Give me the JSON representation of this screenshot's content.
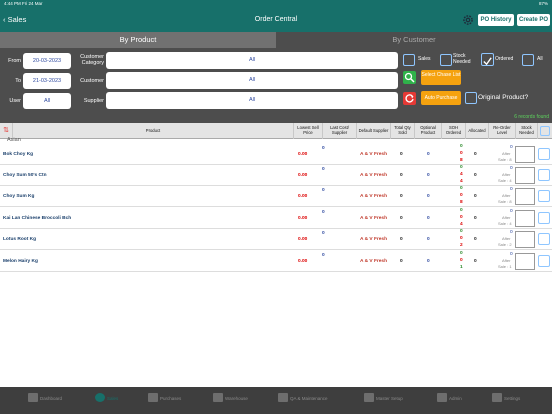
{
  "status": {
    "time": "4:44 PM",
    "date": "Fri 24 Mar",
    "battery": "87%"
  },
  "header": {
    "back_label": "Sales",
    "title": "Order Central",
    "po_history": "PO History",
    "create_po": "Create PO"
  },
  "segments": {
    "by_product": "By Product",
    "by_customer": "By Customer"
  },
  "filters": {
    "from_label": "From",
    "from_value": "20-03-2023",
    "to_label": "To",
    "to_value": "21-03-2023",
    "user_label": "User",
    "user_value": "All",
    "customer_category_label": "Customer Category",
    "customer_category_value": "All",
    "customer_label": "Customer",
    "customer_value": "All",
    "supplier_label": "Supplier",
    "supplier_value": "All",
    "sales_label": "Sales",
    "stock_needed_label": "Stock Needed",
    "ordered_label": "Ordered",
    "all_label": "All",
    "select_chase_list": "Select Chase List",
    "auto_purchase": "Auto Purchase",
    "original_product": "Original Product?",
    "found": "6 records found"
  },
  "table": {
    "headers": [
      "Product",
      "Lowest Sell Price",
      "Last Cost/ Supplier",
      "Default Supplier",
      "Total Qty Sold",
      "Optional Product",
      "SOH Ordered",
      "Allocated",
      "Re-Order Level",
      "Stock Needed"
    ],
    "group": "Asian",
    "rows": [
      {
        "name": "Bok Choy Kg",
        "price": "0.00",
        "last": "0",
        "supplier": "A & V Fresh",
        "qty": "0",
        "opt": "0",
        "soh": "0",
        "ordered": "0",
        "third": "8",
        "alloc": "0",
        "reorder": "0",
        "after": "After",
        "sale": "Sale : 8"
      },
      {
        "name": "Choy Sum 50's Ctn",
        "price": "0.00",
        "last": "0",
        "supplier": "A & V Fresh",
        "qty": "0",
        "opt": "0",
        "soh": "0",
        "ordered": "4",
        "third": "4",
        "alloc": "0",
        "reorder": "0",
        "after": "After",
        "sale": "Sale : 4"
      },
      {
        "name": "Choy Sum Kg",
        "price": "0.00",
        "last": "0",
        "supplier": "A & V Fresh",
        "qty": "0",
        "opt": "0",
        "soh": "0",
        "ordered": "0",
        "third": "8",
        "alloc": "0",
        "reorder": "0",
        "after": "After",
        "sale": "Sale : 8"
      },
      {
        "name": "Kai Lan Chinese Broccoli Bch",
        "price": "0.00",
        "last": "0",
        "supplier": "A & V Fresh",
        "qty": "0",
        "opt": "0",
        "soh": "0",
        "ordered": "0",
        "third": "4",
        "alloc": "0",
        "reorder": "0",
        "after": "After",
        "sale": "Sale : 4"
      },
      {
        "name": "Lotus Root Kg",
        "price": "0.00",
        "last": "0",
        "supplier": "A & V Fresh",
        "qty": "0",
        "opt": "0",
        "soh": "0",
        "ordered": "0",
        "third": "2",
        "alloc": "0",
        "reorder": "0",
        "after": "After",
        "sale": "Sale : 2"
      },
      {
        "name": "Melon Hairy Kg",
        "price": "0.00",
        "last": "0",
        "supplier": "A & V Fresh",
        "qty": "0",
        "opt": "0",
        "soh": "0",
        "ordered": "0",
        "third": "1",
        "alloc": "0",
        "reorder": "0",
        "after": "After",
        "sale": "Sale : 1"
      }
    ]
  },
  "tabbar": [
    "Dashboard",
    "Sales",
    "Purchases",
    "Warehouse",
    "QA & Maintenance",
    "Master Setup",
    "Admin",
    "Settings"
  ]
}
